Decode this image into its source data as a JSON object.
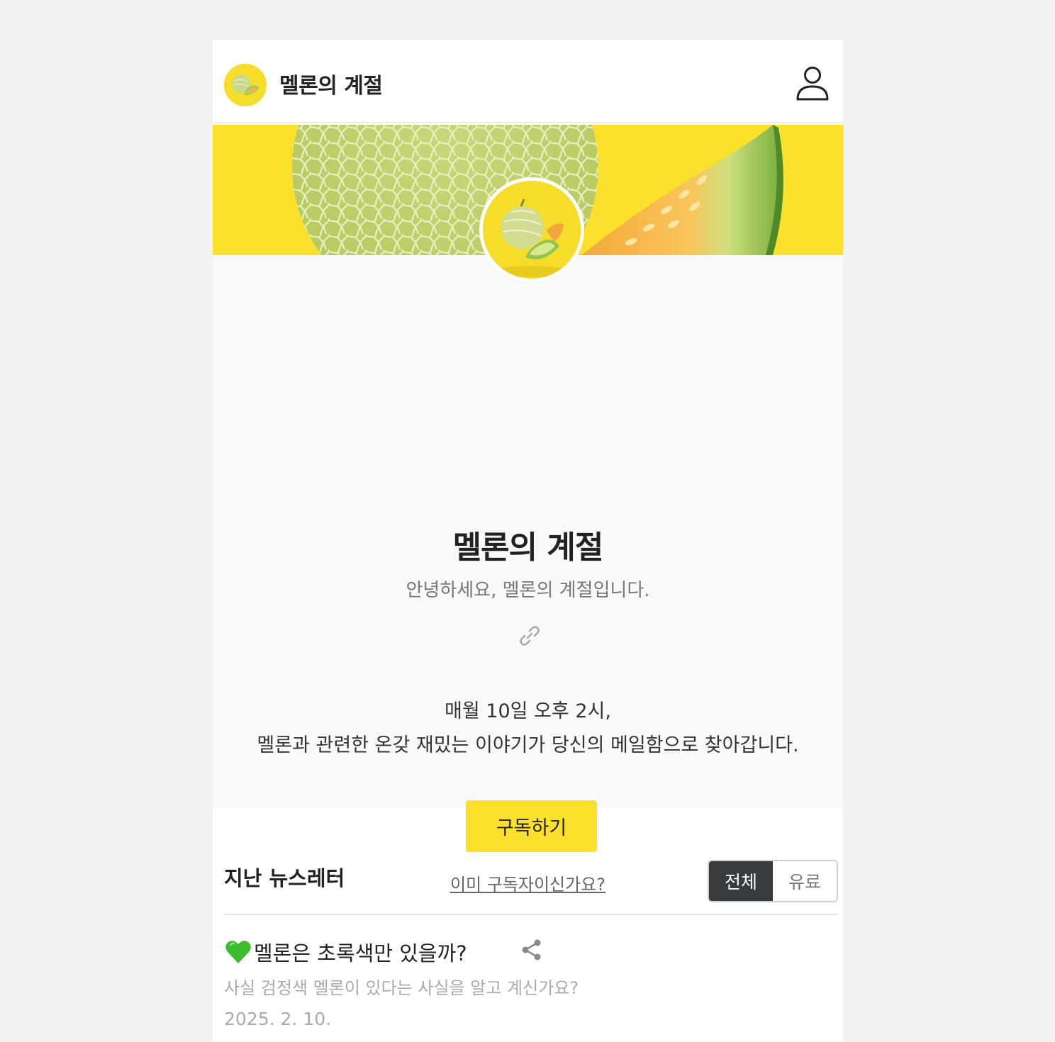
{
  "header": {
    "title": "멜론의 계절"
  },
  "profile": {
    "title": "멜론의 계절",
    "subtitle": "안녕하세요, 멜론의 계절입니다.",
    "description_line1": "매월 10일 오후 2시,",
    "description_line2": "멜론과 관련한 온갖 재밌는 이야기가 당신의 메일함으로 찾아갑니다.",
    "subscribe_label": "구독하기",
    "already_subscribed_label": "이미 구독자이신가요?"
  },
  "archive": {
    "title": "지난 뉴스레터",
    "filters": [
      {
        "label": "전체",
        "active": true
      },
      {
        "label": "유료",
        "active": false
      }
    ],
    "posts": [
      {
        "icon": "green-heart-icon",
        "title": "멜론은 초록색만 있을까?",
        "summary": "사실 검정색 멜론이 있다는 사실을 알고 계신가요?",
        "date": "2025. 2. 10."
      }
    ]
  },
  "colors": {
    "accent": "#fbe12c",
    "filter_active": "#3a3b3f",
    "background": "#f9f9f9"
  }
}
